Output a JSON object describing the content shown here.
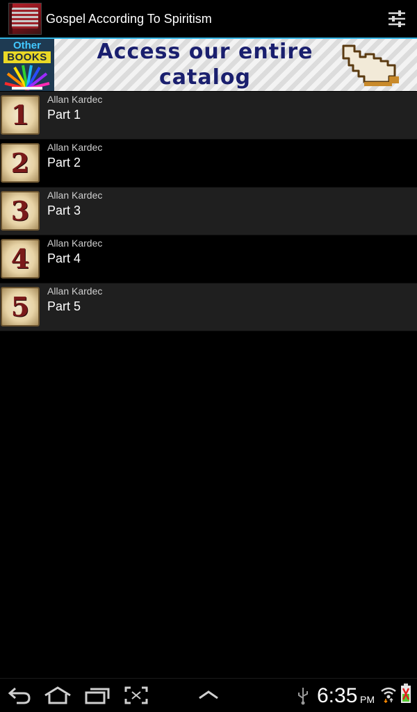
{
  "app": {
    "title": "Gospel According To Spiritism",
    "icon": "book-cover-icon",
    "settings_icon": "sliders-icon"
  },
  "banner": {
    "badge_top": "Other",
    "badge_bottom": "BOOKS",
    "line1": "Access our entire",
    "line2": "catalog",
    "icon": "pointing-hand-icon"
  },
  "items": [
    {
      "number": "1",
      "author": "Allan Kardec",
      "title": "Part 1"
    },
    {
      "number": "2",
      "author": "Allan Kardec",
      "title": "Part 2"
    },
    {
      "number": "3",
      "author": "Allan Kardec",
      "title": "Part 3"
    },
    {
      "number": "4",
      "author": "Allan Kardec",
      "title": "Part 4"
    },
    {
      "number": "5",
      "author": "Allan Kardec",
      "title": "Part 5"
    }
  ],
  "status": {
    "time": "6:35",
    "ampm": "PM"
  },
  "colors": {
    "accent": "#33b5e5",
    "banner_text": "#1a1f6e",
    "row_alt": "#1f1f1f"
  }
}
